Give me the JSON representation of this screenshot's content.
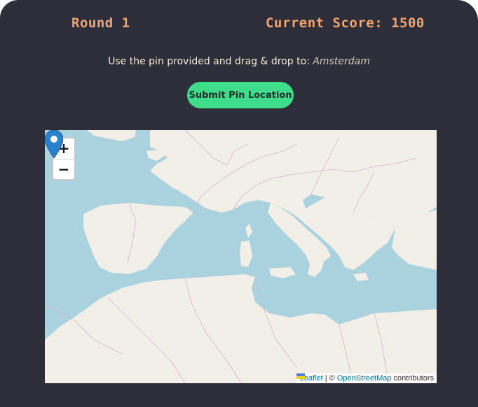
{
  "header": {
    "round_label": "Round 1",
    "score_label": "Current Score: 1500"
  },
  "instruction": {
    "text": "Use the pin provided and drag & drop to: ",
    "city": "Amsterdam"
  },
  "submit_label": "Submit Pin Location",
  "map": {
    "zoom_in": "+",
    "zoom_out": "−",
    "attribution": {
      "leaflet": "Leaflet",
      "separator": " | © ",
      "osm": "OpenStreetMap",
      "suffix": " contributors"
    },
    "marker_icon": "map-pin-icon",
    "colors": {
      "sea": "#aad3df",
      "land": "#f2efe9",
      "border": "#d6b3c8",
      "marker": "#2a81cb"
    }
  },
  "colors": {
    "background": "#2e2e3a",
    "accent": "#f0a56e",
    "button": "#3fdc8b"
  }
}
